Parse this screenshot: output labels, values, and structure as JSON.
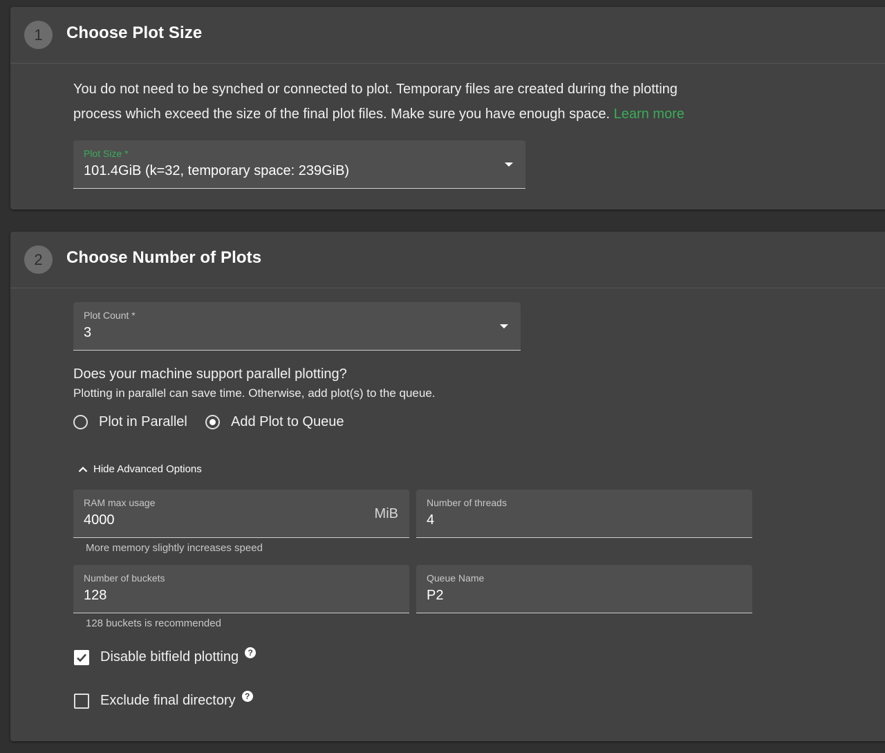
{
  "section1": {
    "step_number": "1",
    "title": "Choose Plot Size",
    "description": "You do not need to be synched or connected to plot. Temporary files are created during the plotting process which exceed the size of the final plot files. Make sure you have enough space.",
    "learn_more": "Learn more",
    "plot_size": {
      "label": "Plot Size *",
      "value": "101.4GiB (k=32, temporary space: 239GiB)"
    }
  },
  "section2": {
    "step_number": "2",
    "title": "Choose Number of Plots",
    "plot_count": {
      "label": "Plot Count *",
      "value": "3"
    },
    "parallel_question": "Does your machine support parallel plotting?",
    "parallel_subtext": "Plotting in parallel can save time. Otherwise, add plot(s) to the queue.",
    "radio_options": [
      {
        "label": "Plot in Parallel",
        "selected": false
      },
      {
        "label": "Add Plot to Queue",
        "selected": true
      }
    ],
    "advanced_toggle": "Hide Advanced Options",
    "ram": {
      "label": "RAM max usage",
      "value": "4000",
      "unit": "MiB",
      "helper": "More memory slightly increases speed"
    },
    "threads": {
      "label": "Number of threads",
      "value": "4"
    },
    "buckets": {
      "label": "Number of buckets",
      "value": "128",
      "helper": "128 buckets is recommended"
    },
    "queue": {
      "label": "Queue Name",
      "value": "P2"
    },
    "disable_bitfield": {
      "label": "Disable bitfield plotting",
      "checked": true
    },
    "exclude_final": {
      "label": "Exclude final directory",
      "checked": false
    }
  },
  "colors": {
    "background": "#303030",
    "card": "#424242",
    "field": "#4f4f4f",
    "accent_green": "#3aac59"
  }
}
